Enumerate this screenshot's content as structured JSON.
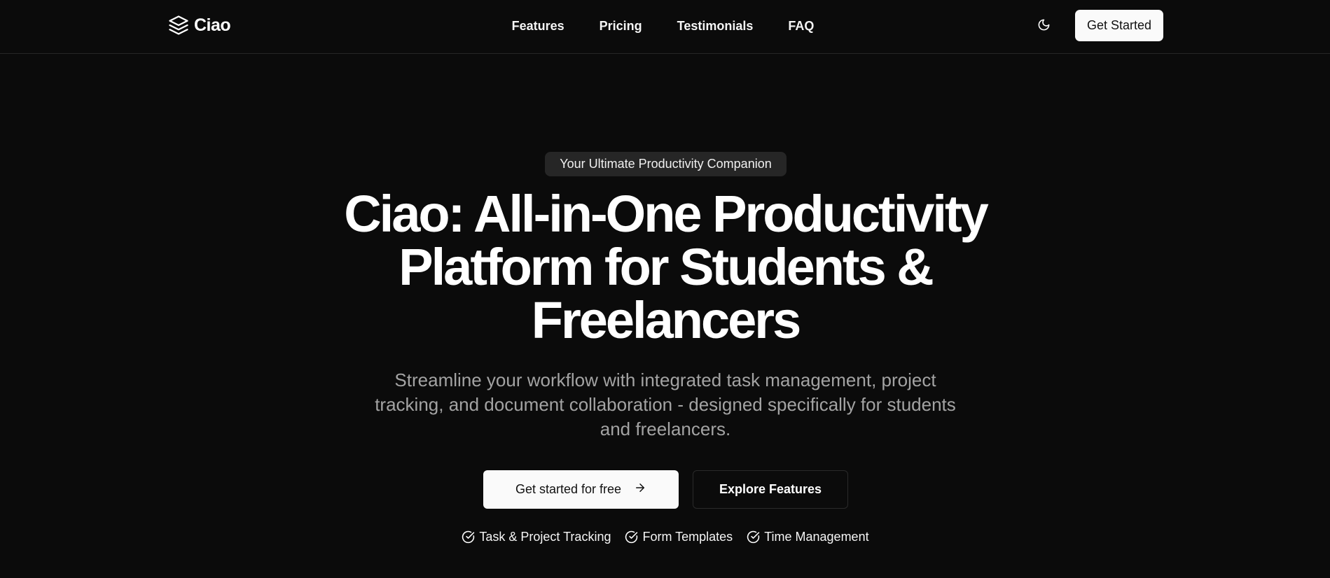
{
  "nav": {
    "brand": "Ciao",
    "brand_icon": "layers-icon",
    "links": [
      "Features",
      "Pricing",
      "Testimonials",
      "FAQ"
    ],
    "theme_icon": "moon-icon",
    "cta": "Get Started"
  },
  "hero": {
    "badge": "Your Ultimate Productivity Companion",
    "title": "Ciao: All-in-One Productivity Platform for Students & Freelancers",
    "subtitle": "Streamline your workflow with integrated task management, project tracking, and document collaboration - designed specifically for students and freelancers.",
    "primary_cta": "Get started for free",
    "primary_cta_icon": "arrow-right-icon",
    "secondary_cta": "Explore Features",
    "features": [
      "Task & Project Tracking",
      "Form Templates",
      "Time Management"
    ],
    "feature_icon": "check-circle-icon"
  },
  "colors": {
    "background": "#0b0b0b",
    "foreground": "#fafafa",
    "muted": "#a3a3a3",
    "badge_bg": "#262626"
  }
}
